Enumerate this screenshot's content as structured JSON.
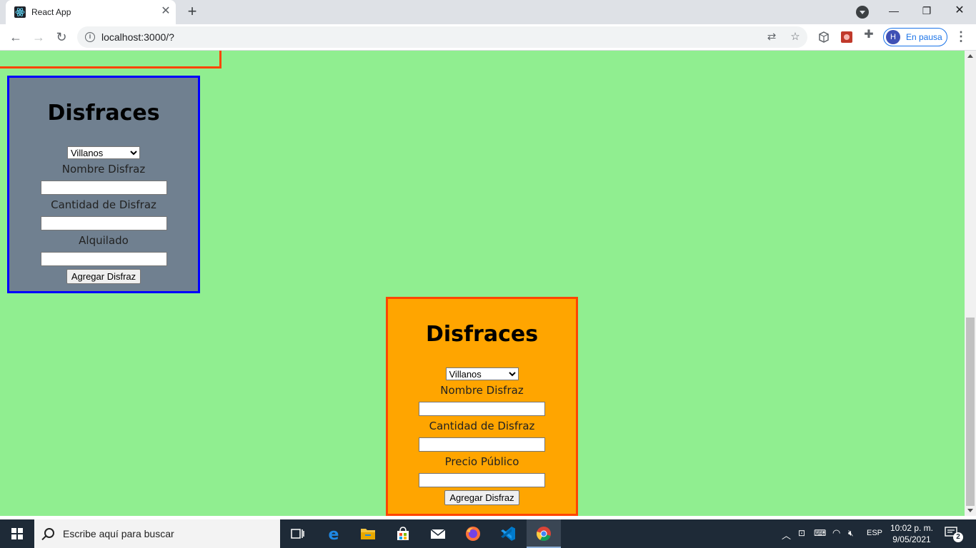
{
  "browser": {
    "tab_title": "React App",
    "url": "localhost:3000/?",
    "profile_initial": "H",
    "profile_status": "En pausa"
  },
  "page": {
    "background": "#90ee90",
    "cards": [
      {
        "title": "Disfraces",
        "background": "#708090",
        "border": "#0000ff",
        "select_value": "Villanos",
        "fields": [
          {
            "label": "Nombre Disfraz",
            "value": ""
          },
          {
            "label": "Cantidad de Disfraz",
            "value": ""
          },
          {
            "label": "Alquilado",
            "value": ""
          }
        ],
        "button_label": "Agregar Disfraz"
      },
      {
        "title": "Disfraces",
        "background": "#ffa500",
        "border": "#ff4500",
        "select_value": "Villanos",
        "fields": [
          {
            "label": "Nombre Disfraz",
            "value": ""
          },
          {
            "label": "Cantidad de Disfraz",
            "value": ""
          },
          {
            "label": "Precio Público",
            "value": ""
          }
        ],
        "button_label": "Agregar Disfraz"
      }
    ]
  },
  "taskbar": {
    "search_placeholder": "Escribe aquí para buscar",
    "apps": [
      "task-view",
      "edge",
      "file-explorer",
      "microsoft-store",
      "mail",
      "firefox",
      "vscode",
      "chrome"
    ],
    "active_app": "chrome",
    "language": "ESP",
    "time": "10:02 p. m.",
    "date": "9/05/2021",
    "notification_count": "2"
  }
}
